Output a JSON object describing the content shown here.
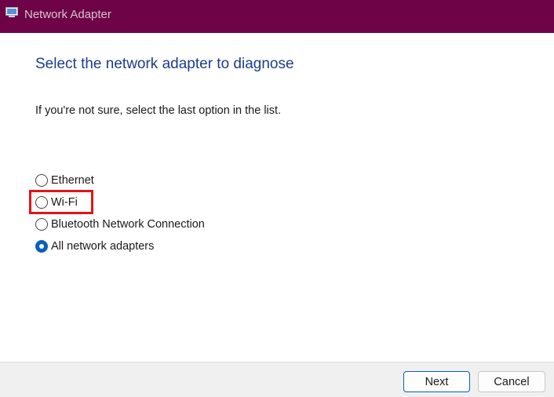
{
  "window": {
    "title": "Network Adapter",
    "icon": "network-adapter-icon",
    "titlebar_color": "#6e0447"
  },
  "main": {
    "heading": "Select the network adapter to diagnose",
    "instruction": "If you're not sure, select the last option in the list.",
    "options": [
      {
        "label": "Ethernet",
        "checked": false
      },
      {
        "label": "Wi-Fi",
        "checked": false,
        "highlighted": true
      },
      {
        "label": "Bluetooth Network Connection",
        "checked": false
      },
      {
        "label": "All network adapters",
        "checked": true
      }
    ],
    "highlight_color": "#e2141c"
  },
  "footer": {
    "next_label": "Next",
    "cancel_label": "Cancel"
  }
}
